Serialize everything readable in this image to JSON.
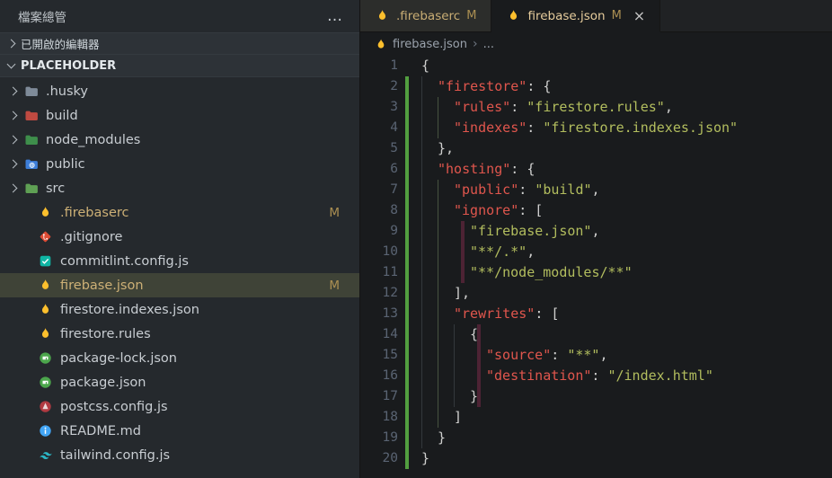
{
  "explorer": {
    "title": "檔案總管",
    "more_label": "…",
    "sections": [
      {
        "label": "已開啟的編輯器",
        "expanded": false
      },
      {
        "label": "PLACEHOLDER",
        "expanded": true
      }
    ],
    "items": [
      {
        "kind": "folder",
        "label": ".husky",
        "icon": "folder",
        "color": "#7f8b99"
      },
      {
        "kind": "folder",
        "label": "build",
        "icon": "folder",
        "color": "#bf4a41"
      },
      {
        "kind": "folder",
        "label": "node_modules",
        "icon": "folder",
        "color": "#3e8e4b"
      },
      {
        "kind": "folder",
        "label": "public",
        "icon": "folder-globe",
        "color": "#3d7ed9"
      },
      {
        "kind": "folder",
        "label": "src",
        "icon": "folder",
        "color": "#5fa054"
      },
      {
        "kind": "file",
        "label": ".firebaserc",
        "icon": "flame",
        "badge": "M",
        "modified": true
      },
      {
        "kind": "file",
        "label": ".gitignore",
        "icon": "git"
      },
      {
        "kind": "file",
        "label": "commitlint.config.js",
        "icon": "commitlint"
      },
      {
        "kind": "file",
        "label": "firebase.json",
        "icon": "flame",
        "badge": "M",
        "modified": true,
        "selected": true
      },
      {
        "kind": "file",
        "label": "firestore.indexes.json",
        "icon": "flame"
      },
      {
        "kind": "file",
        "label": "firestore.rules",
        "icon": "flame"
      },
      {
        "kind": "file",
        "label": "package-lock.json",
        "icon": "package"
      },
      {
        "kind": "file",
        "label": "package.json",
        "icon": "package"
      },
      {
        "kind": "file",
        "label": "postcss.config.js",
        "icon": "postcss"
      },
      {
        "kind": "file",
        "label": "README.md",
        "icon": "readme"
      },
      {
        "kind": "file",
        "label": "tailwind.config.js",
        "icon": "tailwind"
      }
    ]
  },
  "tabs": [
    {
      "label": ".firebaserc",
      "icon": "flame",
      "badge": "M",
      "active": false
    },
    {
      "label": "firebase.json",
      "icon": "flame",
      "badge": "M",
      "active": true,
      "close_label": "×"
    }
  ],
  "breadcrumb": {
    "file": "firebase.json",
    "separator": "›",
    "more": "..."
  },
  "editor": {
    "language": "json",
    "lines": [
      {
        "n": 1,
        "indent": 0,
        "git": false,
        "tokens": [
          [
            "p",
            "{"
          ]
        ]
      },
      {
        "n": 2,
        "indent": 1,
        "git": true,
        "tokens": [
          [
            "k",
            "\"firestore\""
          ],
          [
            "p",
            ": {"
          ]
        ]
      },
      {
        "n": 3,
        "indent": 2,
        "git": true,
        "tokens": [
          [
            "k",
            "\"rules\""
          ],
          [
            "p",
            ": "
          ],
          [
            "s",
            "\"firestore.rules\""
          ],
          [
            "p",
            ","
          ]
        ]
      },
      {
        "n": 4,
        "indent": 2,
        "git": true,
        "tokens": [
          [
            "k",
            "\"indexes\""
          ],
          [
            "p",
            ": "
          ],
          [
            "s",
            "\"firestore.indexes.json\""
          ]
        ]
      },
      {
        "n": 5,
        "indent": 1,
        "git": true,
        "tokens": [
          [
            "p",
            "},"
          ]
        ]
      },
      {
        "n": 6,
        "indent": 1,
        "git": true,
        "tokens": [
          [
            "k",
            "\"hosting\""
          ],
          [
            "p",
            ": {"
          ]
        ]
      },
      {
        "n": 7,
        "indent": 2,
        "git": true,
        "tokens": [
          [
            "k",
            "\"public\""
          ],
          [
            "p",
            ": "
          ],
          [
            "s",
            "\"build\""
          ],
          [
            "p",
            ","
          ]
        ]
      },
      {
        "n": 8,
        "indent": 2,
        "git": true,
        "tokens": [
          [
            "k",
            "\"ignore\""
          ],
          [
            "p",
            ": ["
          ]
        ]
      },
      {
        "n": 9,
        "indent": 3,
        "git": true,
        "bar": 2,
        "tokens": [
          [
            "s",
            "\"firebase.json\""
          ],
          [
            "p",
            ","
          ]
        ]
      },
      {
        "n": 10,
        "indent": 3,
        "git": true,
        "bar": 2,
        "tokens": [
          [
            "s",
            "\"**/.*\""
          ],
          [
            "p",
            ","
          ]
        ]
      },
      {
        "n": 11,
        "indent": 3,
        "git": true,
        "bar": 2,
        "tokens": [
          [
            "s",
            "\"**/node_modules/**\""
          ]
        ]
      },
      {
        "n": 12,
        "indent": 2,
        "git": true,
        "tokens": [
          [
            "p",
            "],"
          ]
        ]
      },
      {
        "n": 13,
        "indent": 2,
        "git": true,
        "tokens": [
          [
            "k",
            "\"rewrites\""
          ],
          [
            "p",
            ": ["
          ]
        ]
      },
      {
        "n": 14,
        "indent": 3,
        "git": true,
        "bar": 3,
        "tokens": [
          [
            "p",
            "{"
          ]
        ]
      },
      {
        "n": 15,
        "indent": 4,
        "git": true,
        "bar": 3,
        "tokens": [
          [
            "k",
            "\"source\""
          ],
          [
            "p",
            ": "
          ],
          [
            "s",
            "\"**\""
          ],
          [
            "p",
            ","
          ]
        ]
      },
      {
        "n": 16,
        "indent": 4,
        "git": true,
        "bar": 3,
        "tokens": [
          [
            "k",
            "\"destination\""
          ],
          [
            "p",
            ": "
          ],
          [
            "s",
            "\"/index.html\""
          ]
        ]
      },
      {
        "n": 17,
        "indent": 3,
        "git": true,
        "bar": 3,
        "tokens": [
          [
            "p",
            "}"
          ]
        ]
      },
      {
        "n": 18,
        "indent": 2,
        "git": true,
        "tokens": [
          [
            "p",
            "]"
          ]
        ]
      },
      {
        "n": 19,
        "indent": 1,
        "git": true,
        "tokens": [
          [
            "p",
            "}"
          ]
        ]
      },
      {
        "n": 20,
        "indent": 0,
        "git": true,
        "tokens": [
          [
            "p",
            "}"
          ]
        ]
      }
    ]
  },
  "theme": {
    "modified_color": "#cdb076",
    "badge_color": "#ab8f52",
    "git_added_gutter": "#529e3f",
    "json_key_color": "#e0564d",
    "json_string_color": "#b2bd5e",
    "punctuation_color": "#d0d0cf",
    "flame_color": "#fcbf2d",
    "selection_row_color": "#3f4337"
  }
}
